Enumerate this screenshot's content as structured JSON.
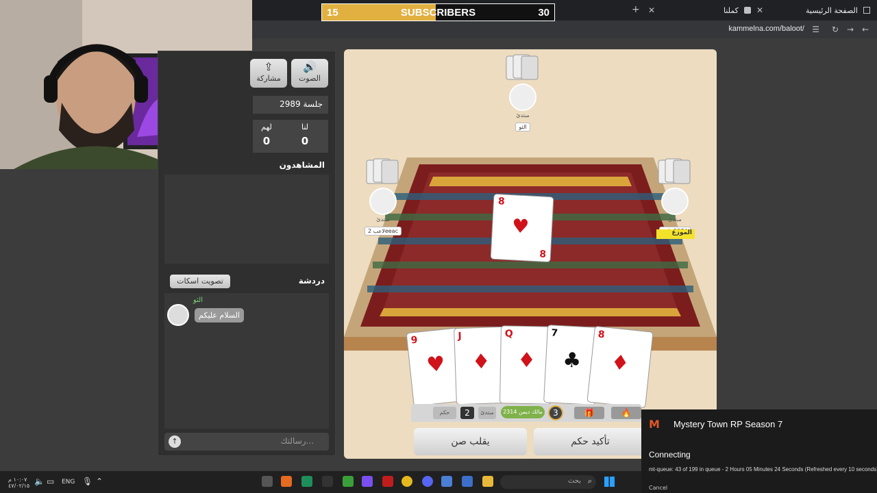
{
  "browser": {
    "tabs": [
      {
        "label": "الصفحة الرئيسية",
        "close": "✕"
      },
      {
        "label": "كملنا",
        "close": "✕"
      }
    ],
    "new_tab": "+",
    "url": "kammelna.com/baloot/"
  },
  "stream_overlay": {
    "subscribers_label": "SUBSCRIBERS",
    "current": "15",
    "goal": "30",
    "progress_fraction": 0.49,
    "accent_color": "#e1b041"
  },
  "sidebar": {
    "sound_label": "الصوت",
    "share_label": "مشاركة",
    "session_label": "جلسة 2989",
    "score": {
      "us_label": "لنا",
      "them_label": "لهم",
      "us_value": "0",
      "them_value": "0"
    },
    "spectators_title": "المشاهدون",
    "chat_title": "دردشة",
    "mute_vote_label": "تصويت اسكات",
    "chat_messages": [
      {
        "name": "الثو",
        "text": "السلام عليكم"
      }
    ],
    "message_placeholder": "رسالتك..."
  },
  "table": {
    "players": [
      {
        "position": "top",
        "level": "مبتدئ",
        "name": "الثو"
      },
      {
        "position": "left",
        "level": "مبتدئ",
        "name": "لاعب 2eeac"
      },
      {
        "position": "right",
        "level": "مبتدئ",
        "name": "zak 1974"
      }
    ],
    "dealer_label": "الموزع",
    "played_card": {
      "rank": "8",
      "suit": "♥",
      "color": "red"
    },
    "hand": [
      {
        "rank": "9",
        "suit": "♥",
        "color": "red"
      },
      {
        "rank": "J",
        "suit": "♦",
        "color": "red"
      },
      {
        "rank": "Q",
        "suit": "♦",
        "color": "red"
      },
      {
        "rank": "7",
        "suit": "♣",
        "color": "black"
      },
      {
        "rank": "8",
        "suit": "♦",
        "color": "red"
      }
    ],
    "hud": {
      "hokm_chip": "حكم",
      "count": "2",
      "level_chip": "مبتدئ",
      "points": "مالك ديمن 2314",
      "timer": "3"
    },
    "actions": {
      "flip_sun": "يقلب صن",
      "confirm_hokm": "تأكيد حكم"
    }
  },
  "notification": {
    "title": "Mystery Town RP Season 7",
    "status": "Connecting",
    "detail": "mt-queue: 43 of 199 in queue - 2 Hours 05 Minutes 24 Seconds (Refreshed every 10 seconds)",
    "cancel": "Cancel"
  },
  "taskbar": {
    "language": "ENG",
    "search_placeholder": "بحث",
    "time": "١٠:٠٧ م",
    "date": "٤٧/٠٢/١٥"
  }
}
